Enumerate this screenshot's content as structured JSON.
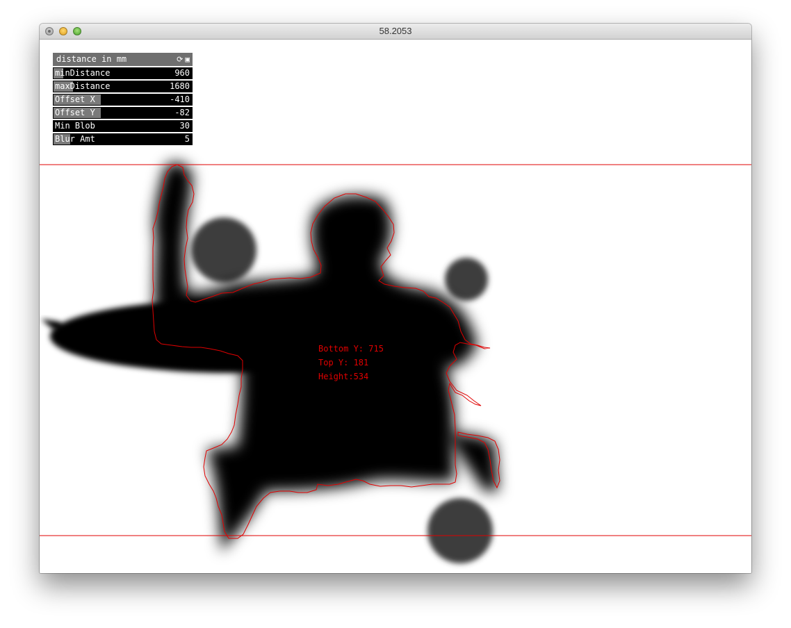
{
  "window": {
    "title": "58.2053"
  },
  "panel": {
    "title": "distance in mm",
    "icons": [
      "refresh-icon",
      "save-icon"
    ],
    "sliders": [
      {
        "label": "minDistance",
        "value": "960",
        "fill": 0.07
      },
      {
        "label": "maxDistance",
        "value": "1680",
        "fill": 0.14
      },
      {
        "label": "Offset X",
        "value": "-410",
        "fill": 0.34
      },
      {
        "label": "Offset Y",
        "value": "-82",
        "fill": 0.34
      },
      {
        "label": "Min Blob",
        "value": "30",
        "fill": 0.0
      },
      {
        "label": "Blur Amt",
        "value": "5",
        "fill": 0.12
      }
    ]
  },
  "overlay": {
    "bottom_y": "Bottom Y: 715",
    "top_y": "Top Y: 181",
    "height": "Height:534"
  },
  "colors": {
    "detection": "#e00000",
    "blob": "#000000",
    "panel_header": "#6f6f6f"
  }
}
